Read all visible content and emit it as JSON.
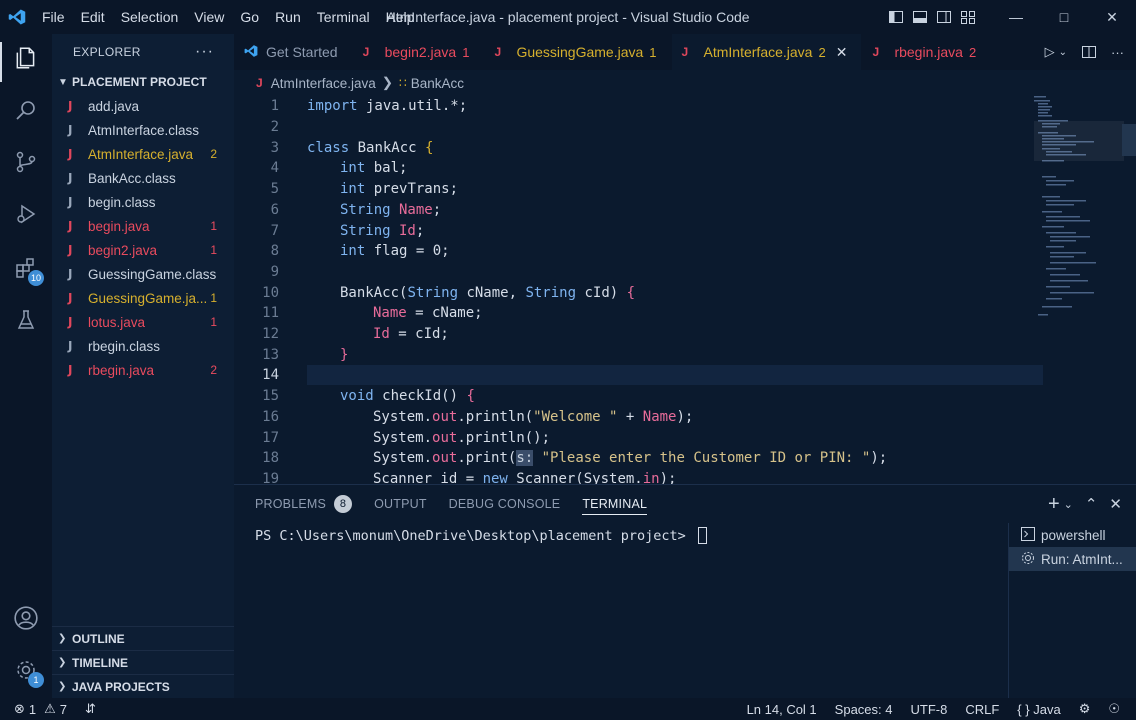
{
  "titlebar": {
    "menu": [
      "File",
      "Edit",
      "Selection",
      "View",
      "Go",
      "Run",
      "Terminal",
      "Help"
    ],
    "title": "AtmInterface.java - placement project - Visual Studio Code"
  },
  "activity": {
    "extensions_badge": "10",
    "manage_badge": "1"
  },
  "sidebar": {
    "header": "EXPLORER",
    "project": "PLACEMENT PROJECT",
    "files": [
      {
        "name": "add.java",
        "count": "",
        "status": "ok"
      },
      {
        "name": "AtmInterface.class",
        "count": "",
        "status": "ok"
      },
      {
        "name": "AtmInterface.java",
        "count": "2",
        "status": "warn"
      },
      {
        "name": "BankAcc.class",
        "count": "",
        "status": "ok"
      },
      {
        "name": "begin.class",
        "count": "",
        "status": "ok"
      },
      {
        "name": "begin.java",
        "count": "1",
        "status": "err"
      },
      {
        "name": "begin2.java",
        "count": "1",
        "status": "err"
      },
      {
        "name": "GuessingGame.class",
        "count": "",
        "status": "ok"
      },
      {
        "name": "GuessingGame.ja...",
        "count": "1",
        "status": "warn"
      },
      {
        "name": "lotus.java",
        "count": "1",
        "status": "err"
      },
      {
        "name": "rbegin.class",
        "count": "",
        "status": "ok"
      },
      {
        "name": "rbegin.java",
        "count": "2",
        "status": "err"
      }
    ],
    "outline": "OUTLINE",
    "timeline": "TIMELINE",
    "java_projects": "JAVA PROJECTS"
  },
  "tabs": [
    {
      "label": "Get Started",
      "num": "",
      "status": "plain"
    },
    {
      "label": "begin2.java",
      "num": "1",
      "status": "err"
    },
    {
      "label": "GuessingGame.java",
      "num": "1",
      "status": "warn"
    },
    {
      "label": "AtmInterface.java",
      "num": "2",
      "status": "warn",
      "active": true
    },
    {
      "label": "rbegin.java",
      "num": "2",
      "status": "err"
    }
  ],
  "breadcrumb": {
    "file": "AtmInterface.java",
    "symbol": "BankAcc"
  },
  "editor": {
    "line_numbers": [
      "1",
      "2",
      "3",
      "4",
      "5",
      "6",
      "7",
      "8",
      "9",
      "10",
      "11",
      "12",
      "13",
      "14",
      "15",
      "16",
      "17",
      "18",
      "19"
    ],
    "tokens": {
      "l1_kw": "import",
      "l1_rest": " java.util.*;",
      "l3_kw": "class",
      "l3_name": " BankAcc ",
      "l3_brace": "{",
      "l4_ty": "int",
      "l4_rest": " bal;",
      "l5_ty": "int",
      "l5_rest": " prevTrans;",
      "l6_ty": "String",
      "l6_fld": " Name",
      "l6_end": ";",
      "l7_ty": "String",
      "l7_fld": " Id",
      "l7_end": ";",
      "l8_ty": "int",
      "l8_rest": " flag = 0;",
      "l10_a": "BankAcc(",
      "l10_ty1": "String",
      "l10_b": " cName, ",
      "l10_ty2": "String",
      "l10_c": " cId) ",
      "l10_brace": "{",
      "l11_fld": "Name",
      "l11_rest": " = cName;",
      "l12_fld": "Id",
      "l12_rest": " = cId;",
      "l13_brace": "}",
      "l15_kw": "void",
      "l15_rest": " checkId() ",
      "l15_brace": "{",
      "l16_a": "System.",
      "l16_out": "out",
      "l16_b": ".println(",
      "l16_str": "\"Welcome \"",
      "l16_c": " + ",
      "l16_fld": "Name",
      "l16_d": ");",
      "l17_a": "System.",
      "l17_out": "out",
      "l17_b": ".println();",
      "l18_a": "System.",
      "l18_out": "out",
      "l18_b": ".print(",
      "l18_hint": "s:",
      "l18_sp": " ",
      "l18_str": "\"Please enter the Customer ID or PIN: \"",
      "l18_c": ");",
      "l19_a": "Scanner id = ",
      "l19_kw": "new",
      "l19_b": " Scanner(System.",
      "l19_in": "in",
      "l19_c": ");"
    }
  },
  "panel": {
    "tabs": [
      "PROBLEMS",
      "OUTPUT",
      "DEBUG CONSOLE",
      "TERMINAL"
    ],
    "problems_count": "8",
    "prompt": "PS C:\\Users\\monum\\OneDrive\\Desktop\\placement project> ",
    "terminals": [
      "powershell",
      "Run: AtmInt..."
    ]
  },
  "status": {
    "errors": "1",
    "warnings": "7",
    "position": "Ln 14, Col 1",
    "spaces": "Spaces: 4",
    "encoding": "UTF-8",
    "eol": "CRLF",
    "language": "Java"
  },
  "colors": {
    "background": "#0b1a2e",
    "error": "#e94b5e",
    "warning": "#d6b02e",
    "keyword": "#7fb4f0"
  }
}
